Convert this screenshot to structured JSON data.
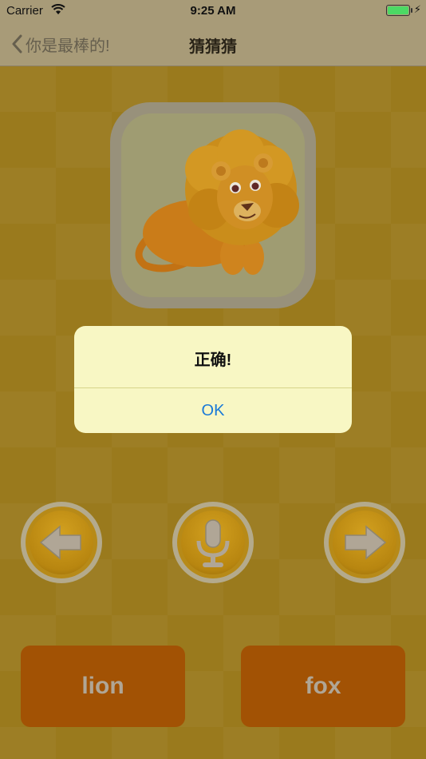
{
  "status_bar": {
    "carrier": "Carrier",
    "time": "9:25 AM"
  },
  "nav": {
    "back_label": "你是最棒的!",
    "title": "猜猜猜"
  },
  "picture": {
    "subject": "lion-illustration"
  },
  "alert": {
    "title": "正确!",
    "ok_label": "OK"
  },
  "controls": {
    "prev": "arrow-left-icon",
    "mic": "microphone-icon",
    "next": "arrow-right-icon"
  },
  "answers": [
    {
      "label": "lion"
    },
    {
      "label": "fox"
    }
  ],
  "colors": {
    "background": "#a07f1f",
    "answer_button": "#a25204",
    "alert_bg": "#f8f7c4",
    "alert_button_text": "#1a7ad8"
  }
}
